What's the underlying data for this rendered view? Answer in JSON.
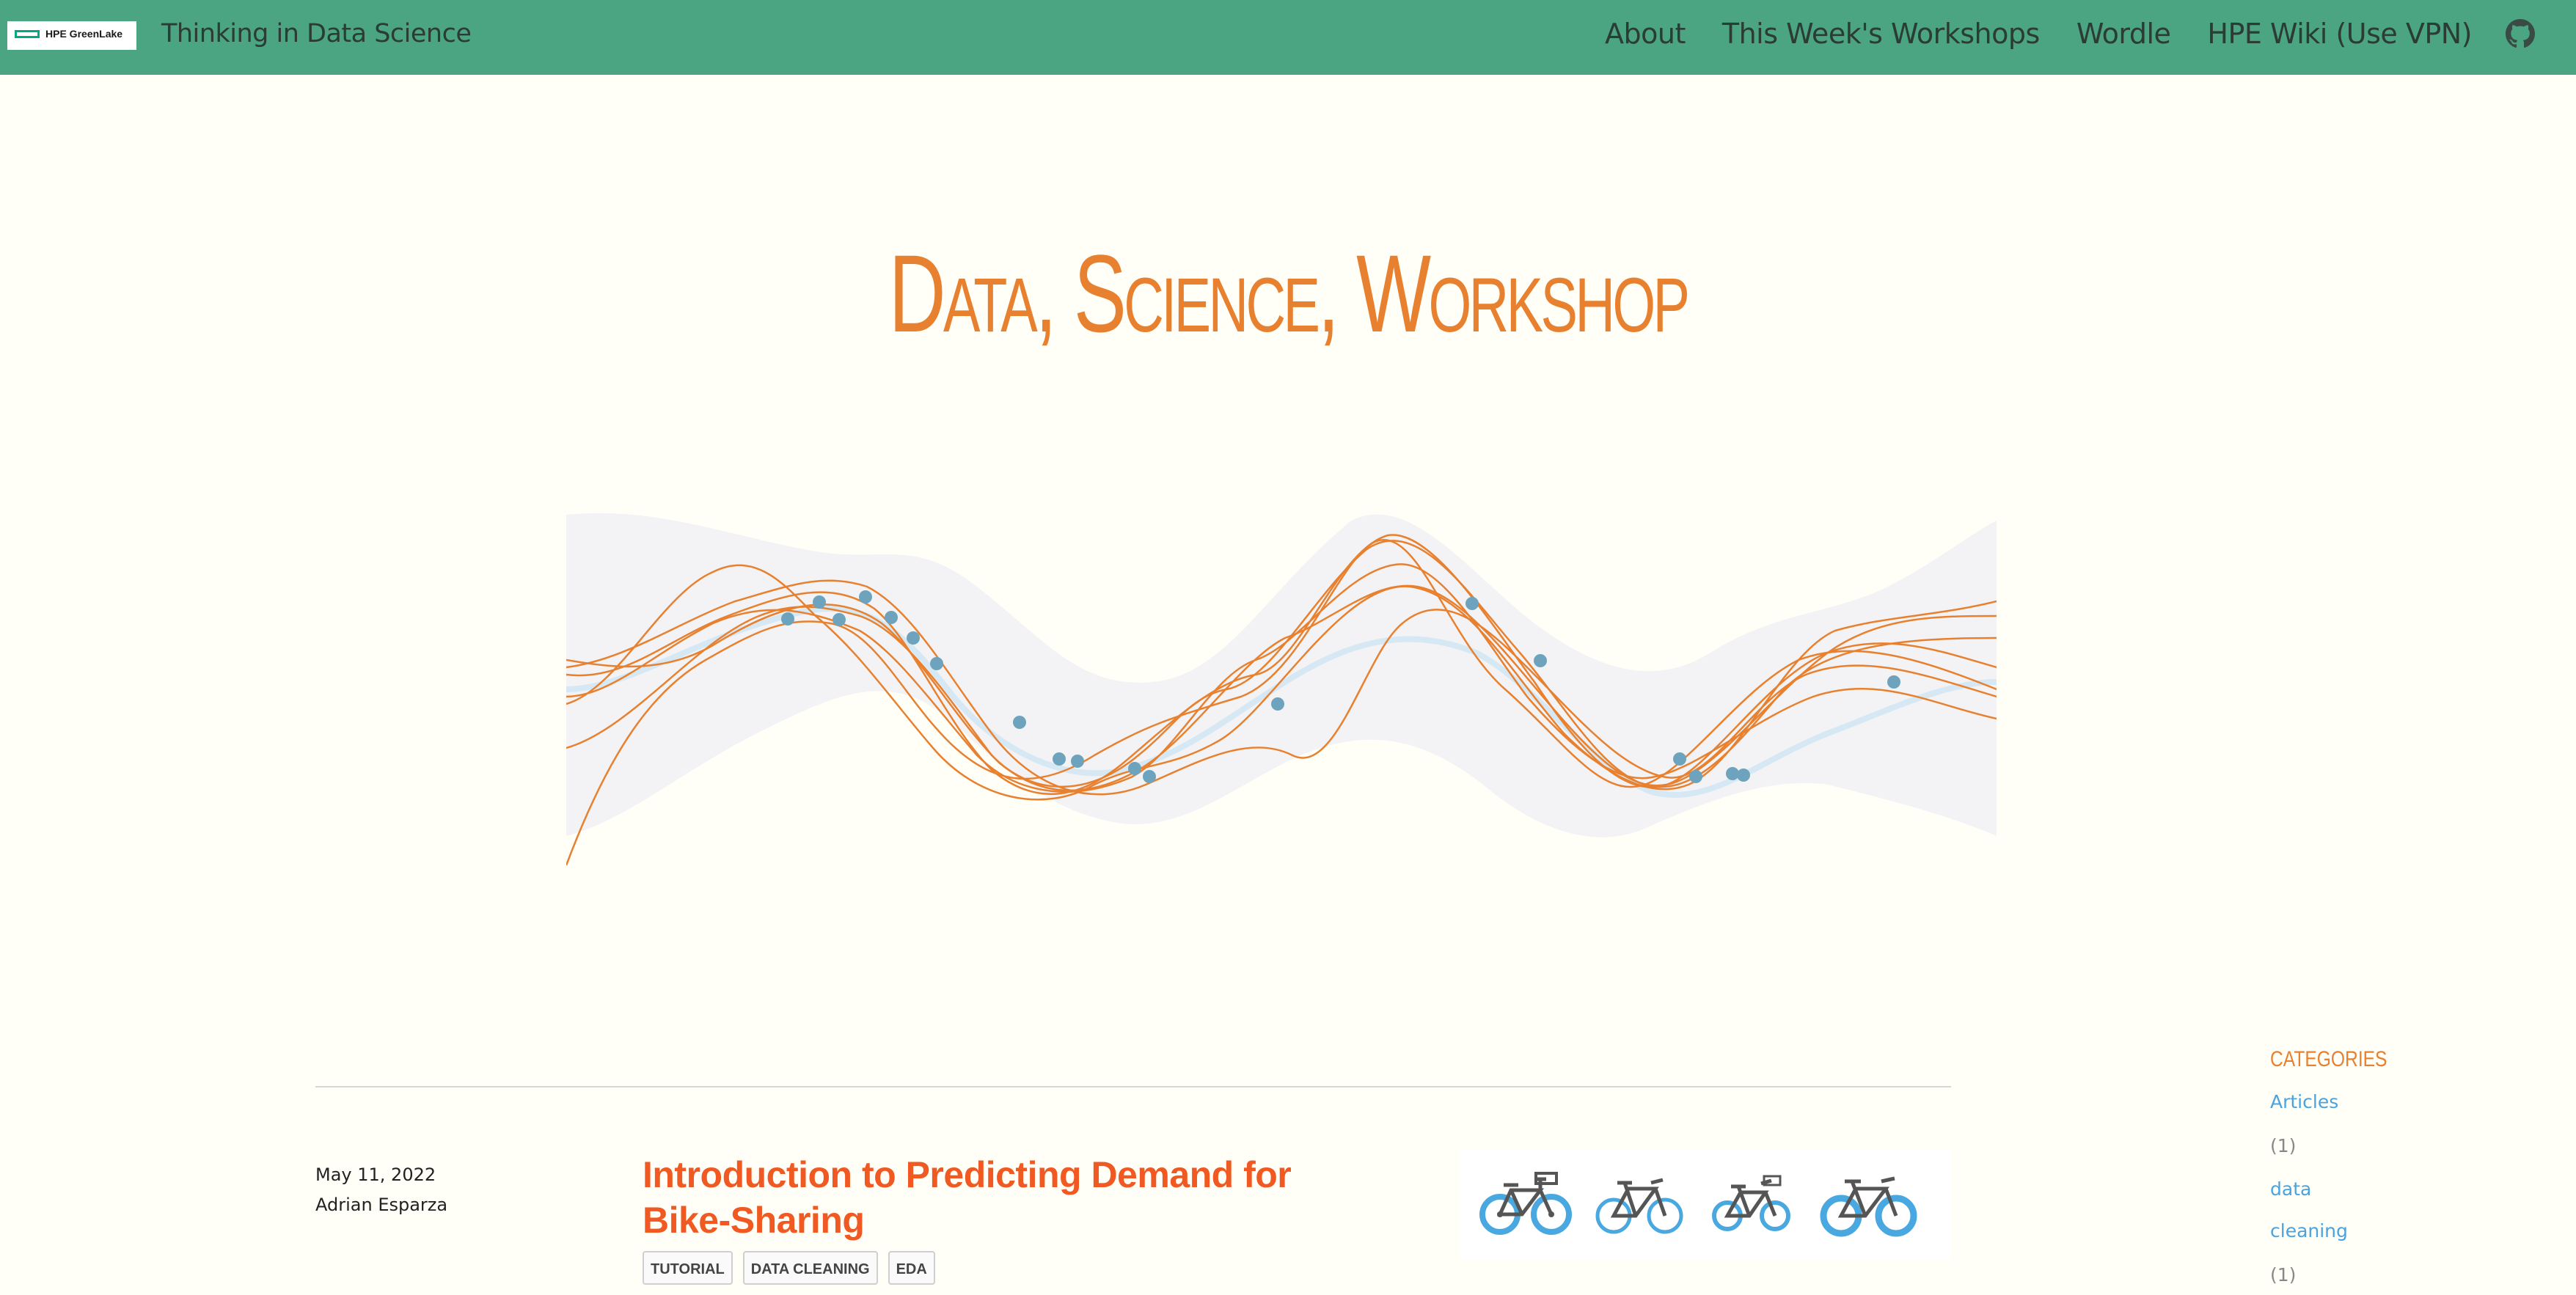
{
  "navbar": {
    "logo_text": "HPE GreenLake",
    "site_title": "Thinking in Data Science",
    "links": [
      "About",
      "This Week's Workshops",
      "Wordle",
      "HPE Wiki (Use VPN)"
    ],
    "github_icon": "github-icon"
  },
  "hero": {
    "title": "Data, Science, Workshop",
    "figure_colors": {
      "samples": "#e8812f",
      "mean": "#d6e8f3",
      "band": "#f1f1f4",
      "points": "#6ea3bd"
    }
  },
  "post": {
    "date": "May 11, 2022",
    "author": "Adrian Esparza",
    "title": "Introduction to Predicting Demand for Bike-Sharing",
    "tags": [
      "TUTORIAL",
      "DATA CLEANING",
      "EDA"
    ],
    "thumbnail_icon": "bicycle-icon"
  },
  "sidebar": {
    "heading": "CATEGORIES",
    "items": [
      {
        "label": "Articles",
        "count": "(1)"
      },
      {
        "label_line1": "data",
        "label_line2": "cleaning",
        "count": "(1)"
      }
    ]
  }
}
